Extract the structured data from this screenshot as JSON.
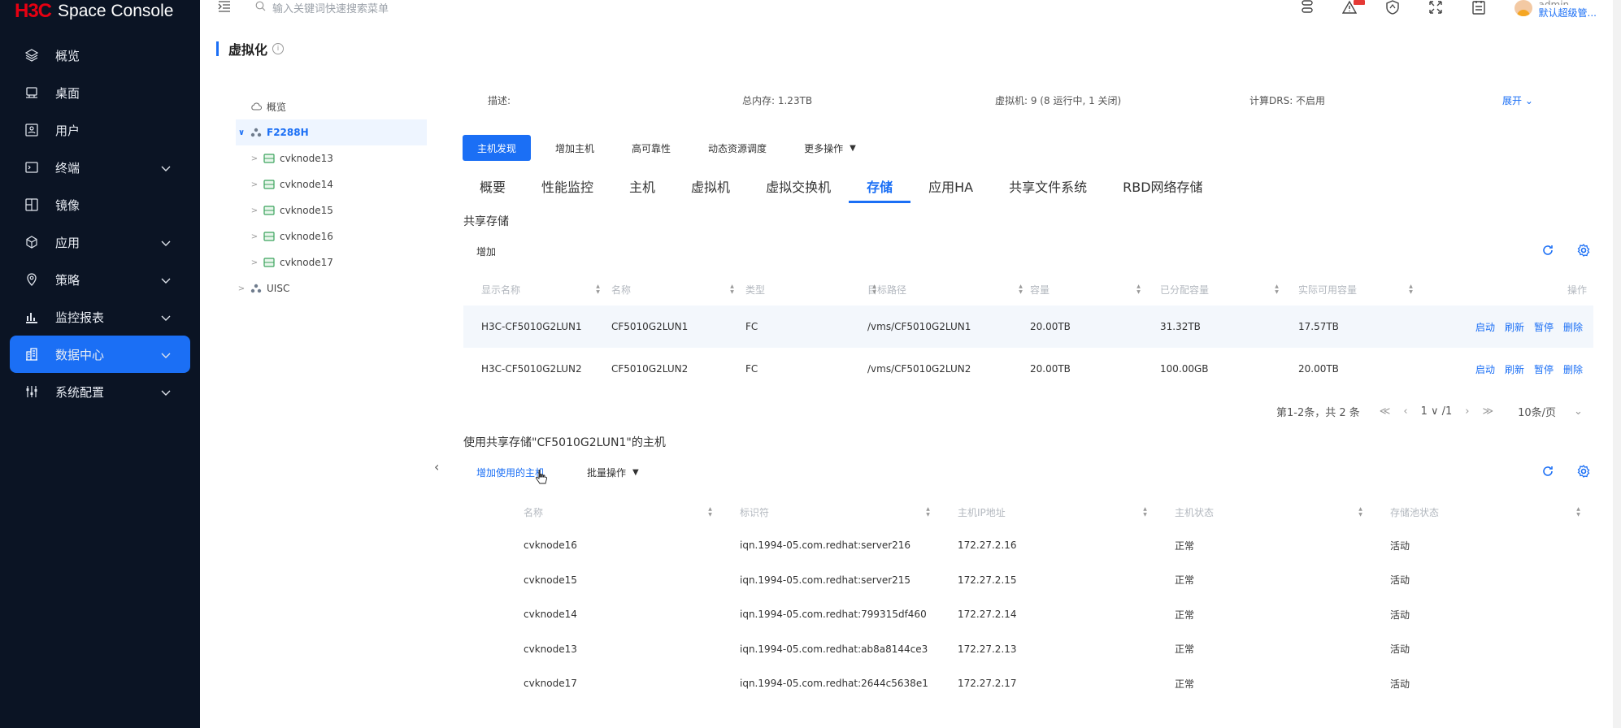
{
  "brand": {
    "logo": "H3C",
    "name": "Space Console"
  },
  "search": {
    "placeholder": "输入关键词快速搜索菜单"
  },
  "user": {
    "name": "admin",
    "role": "默认超级管..."
  },
  "sidebar": {
    "items": [
      {
        "label": "概览",
        "icon": "layers-icon",
        "expandable": false
      },
      {
        "label": "桌面",
        "icon": "desktop-icon",
        "expandable": false
      },
      {
        "label": "用户",
        "icon": "user-icon",
        "expandable": false
      },
      {
        "label": "终端",
        "icon": "terminal-icon",
        "expandable": true
      },
      {
        "label": "镜像",
        "icon": "image-icon",
        "expandable": false
      },
      {
        "label": "应用",
        "icon": "app-icon",
        "expandable": true
      },
      {
        "label": "策略",
        "icon": "location-icon",
        "expandable": true
      },
      {
        "label": "监控报表",
        "icon": "chart-icon",
        "expandable": true
      },
      {
        "label": "数据中心",
        "icon": "datacenter-icon",
        "expandable": true,
        "active": true
      },
      {
        "label": "系统配置",
        "icon": "settings-icon",
        "expandable": true
      }
    ]
  },
  "page": {
    "title": "虚拟化",
    "info": "i"
  },
  "tree": {
    "items": [
      {
        "label": "概览",
        "level": 0,
        "arrow": "",
        "icon": "cloud-icon"
      },
      {
        "label": "F2288H",
        "level": 0,
        "arrow": "∨",
        "icon": "cluster-icon",
        "selected": true
      },
      {
        "label": "cvknode13",
        "level": 1,
        "arrow": ">",
        "icon": "host-icon"
      },
      {
        "label": "cvknode14",
        "level": 1,
        "arrow": ">",
        "icon": "host-icon"
      },
      {
        "label": "cvknode15",
        "level": 1,
        "arrow": ">",
        "icon": "host-icon"
      },
      {
        "label": "cvknode16",
        "level": 1,
        "arrow": ">",
        "icon": "host-icon"
      },
      {
        "label": "cvknode17",
        "level": 1,
        "arrow": ">",
        "icon": "host-icon"
      },
      {
        "label": "UISC",
        "level": 0,
        "arrow": ">",
        "icon": "cluster-icon"
      }
    ]
  },
  "summary": {
    "desc": "描述:",
    "memory": "总内存:  1.23TB",
    "vms": "虚拟机:  9 (8 运行中, 1 关闭)",
    "drs": "计算DRS:  不启用",
    "expand": "展开 ⌄"
  },
  "actions": {
    "discover": "主机发现",
    "add_host": "增加主机",
    "ha": "高可靠性",
    "drs": "动态资源调度",
    "more": "更多操作"
  },
  "tabs": [
    "概要",
    "性能监控",
    "主机",
    "虚拟机",
    "虚拟交换机",
    "存储",
    "应用HA",
    "共享文件系统",
    "RBD网络存储"
  ],
  "active_tab": 5,
  "shared_storage": {
    "title": "共享存储",
    "add": "增加",
    "columns": [
      "显示名称",
      "名称",
      "类型",
      "目标路径",
      "容量",
      "已分配容量",
      "实际可用容量",
      "操作"
    ],
    "rows": [
      {
        "display": "H3C-CF5010G2LUN1",
        "name": "CF5010G2LUN1",
        "type": "FC",
        "path": "/vms/CF5010G2LUN1",
        "capacity": "20.00TB",
        "allocated": "31.32TB",
        "available": "17.57TB"
      },
      {
        "display": "H3C-CF5010G2LUN2",
        "name": "CF5010G2LUN2",
        "type": "FC",
        "path": "/vms/CF5010G2LUN2",
        "capacity": "20.00TB",
        "allocated": "100.00GB",
        "available": "20.00TB"
      }
    ],
    "ops": [
      "启动",
      "刷新",
      "暂停",
      "删除"
    ]
  },
  "pager": {
    "summary": "第1-2条，共 2 条",
    "first": "≪",
    "prev": "‹",
    "page": "1 ∨ /1",
    "next": "›",
    "last": "≫",
    "size": "10条/页"
  },
  "hosts_section": {
    "title": "使用共享存储\"CF5010G2LUN1\"的主机",
    "add": "增加使用的主机",
    "batch": "批量操作",
    "columns": [
      "名称",
      "标识符",
      "主机IP地址",
      "主机状态",
      "存储池状态"
    ],
    "rows": [
      {
        "name": "cvknode16",
        "id": "iqn.1994-05.com.redhat:server216",
        "ip": "172.27.2.16",
        "host_status": "正常",
        "pool_status": "活动"
      },
      {
        "name": "cvknode15",
        "id": "iqn.1994-05.com.redhat:server215",
        "ip": "172.27.2.15",
        "host_status": "正常",
        "pool_status": "活动"
      },
      {
        "name": "cvknode14",
        "id": "iqn.1994-05.com.redhat:799315df460",
        "ip": "172.27.2.14",
        "host_status": "正常",
        "pool_status": "活动"
      },
      {
        "name": "cvknode13",
        "id": "iqn.1994-05.com.redhat:ab8a8144ce3",
        "ip": "172.27.2.13",
        "host_status": "正常",
        "pool_status": "活动"
      },
      {
        "name": "cvknode17",
        "id": "iqn.1994-05.com.redhat:2644c5638e1",
        "ip": "172.27.2.17",
        "host_status": "正常",
        "pool_status": "活动"
      }
    ]
  },
  "colors": {
    "accent": "#1b6ff5",
    "sidebar_bg": "#0b1424",
    "brand_red": "#e60012"
  }
}
